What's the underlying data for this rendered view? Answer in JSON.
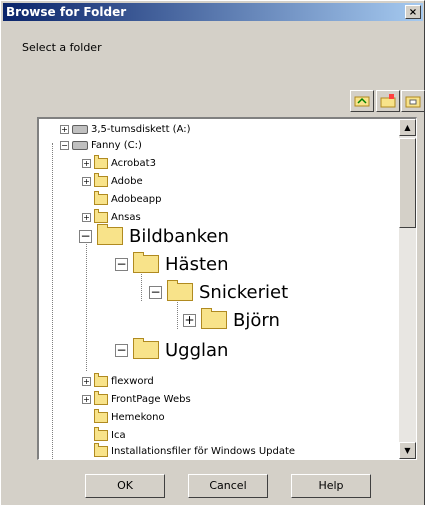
{
  "window": {
    "title": "Browse for Folder",
    "close": "×"
  },
  "prompt": "Select a folder",
  "tree": {
    "items": [
      {
        "label": "3,5-tumsdiskett (A:)",
        "type": "drive"
      },
      {
        "label": "Fanny (C:)",
        "type": "drive"
      },
      {
        "label": "Acrobat3"
      },
      {
        "label": "Adobe"
      },
      {
        "label": "Adobeapp"
      },
      {
        "label": "Ansas"
      },
      {
        "label": "Bildbanken",
        "zoom": true
      },
      {
        "label": "Hästen",
        "zoom": true
      },
      {
        "label": "Snickeriet",
        "zoom": true
      },
      {
        "label": "Björn",
        "zoom": true
      },
      {
        "label": "Ugglan",
        "zoom": true
      },
      {
        "label": "flexword"
      },
      {
        "label": "FrontPage Webs"
      },
      {
        "label": "Hemekono"
      },
      {
        "label": "Ica"
      },
      {
        "label": "Installationsfiler för Windows Update"
      }
    ],
    "expanders": {
      "plus": "+",
      "minus": "−"
    },
    "scroll_up": "▲",
    "scroll_down": "▼"
  },
  "buttons": {
    "ok": "OK",
    "cancel": "Cancel",
    "help": "Help"
  }
}
